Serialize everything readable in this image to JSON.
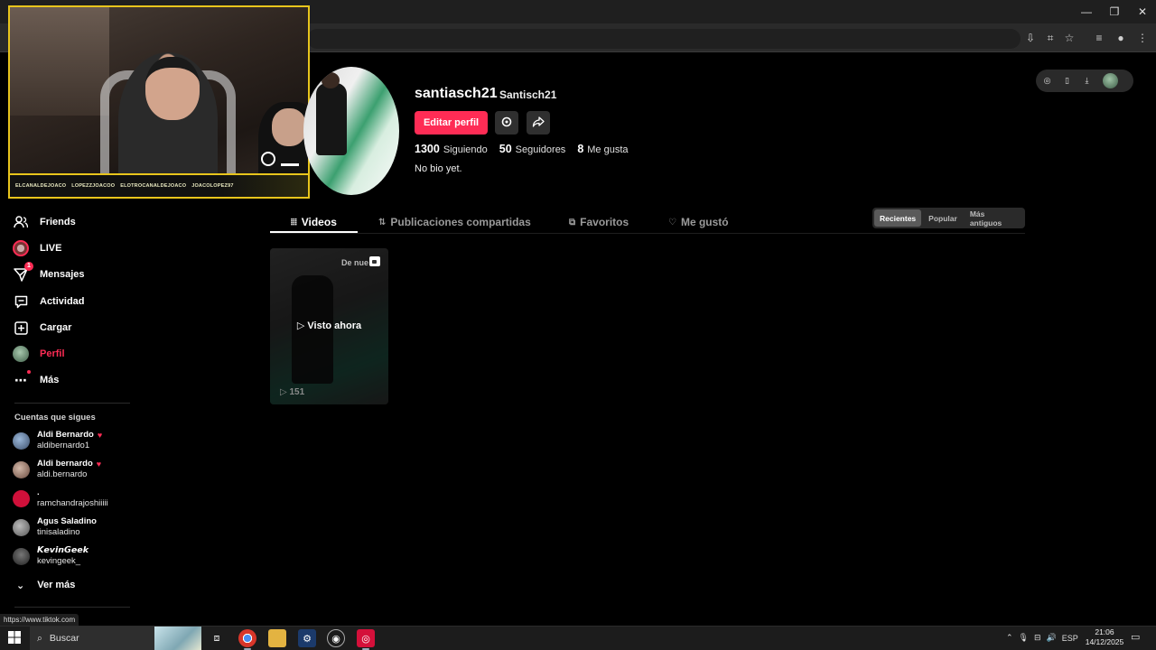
{
  "browser": {
    "window_controls": {
      "minimize": "—",
      "maximize": "❐",
      "close": "✕"
    },
    "toolbar_icons": [
      "install-icon",
      "translate-icon",
      "star-icon",
      "media-icon",
      "profile-icon",
      "menu-icon"
    ],
    "status_url": "https://www.tiktok.com"
  },
  "stream_overlay": {
    "ticker": [
      "ELCANALDEJOACO",
      "LOPEZZJOACOO",
      "ELOTROCANALDEJOACO",
      "JOACOLOPEZ97"
    ]
  },
  "sidebar": {
    "items": [
      {
        "label": "Friends",
        "icon": "friends-icon"
      },
      {
        "label": "LIVE",
        "icon": "live-avatar-icon"
      },
      {
        "label": "Mensajes",
        "icon": "messages-icon",
        "badge": "1"
      },
      {
        "label": "Actividad",
        "icon": "activity-icon"
      },
      {
        "label": "Cargar",
        "icon": "upload-icon"
      },
      {
        "label": "Perfil",
        "icon": "profile-avatar-icon"
      },
      {
        "label": "Más",
        "icon": "more-icon"
      }
    ],
    "following_title": "Cuentas que sigues",
    "accounts": [
      {
        "name": "Aldi Bernardo",
        "handle": "aldibernardo1",
        "heart": "♥"
      },
      {
        "name": "Aldi bernardo",
        "handle": "aldi.bernardo",
        "heart": "♥"
      },
      {
        "name": ".",
        "handle": "ramchandrajoshiiiii",
        "heart": ""
      },
      {
        "name": "Agus Saladino",
        "handle": "tinisaladino",
        "heart": ""
      },
      {
        "name": "𝙆𝙚𝙫𝙞𝙣𝙂𝙚𝙚𝙠",
        "handle": "kevingeek_",
        "heart": ""
      }
    ],
    "see_more": "Ver más"
  },
  "profile": {
    "username": "santiasch21",
    "nickname": "Santisch21",
    "edit_button": "Editar perfil",
    "stats": {
      "following_count": "1300",
      "following_label": "Siguiendo",
      "followers_count": "50",
      "followers_label": "Seguidores",
      "likes_count": "8",
      "likes_label": "Me gusta"
    },
    "bio": "No bio yet."
  },
  "tabs": [
    {
      "label": "Videos",
      "icon": "⦙⦙⦙"
    },
    {
      "label": "Publicaciones compartidas",
      "icon": "⇅"
    },
    {
      "label": "Favoritos",
      "icon": "⧉"
    },
    {
      "label": "Me gustó",
      "icon": "♡"
    }
  ],
  "sort": {
    "options": [
      "Recientes",
      "Popular",
      "Más antiguos"
    ],
    "selected": "Recientes"
  },
  "videos": [
    {
      "label": "De nue",
      "watched": "▷ Visto ahora",
      "views": "▷ 151"
    }
  ],
  "taskbar": {
    "search_placeholder": "Buscar",
    "language": "ESP",
    "time": "21:06",
    "date": "14/12/2025"
  }
}
